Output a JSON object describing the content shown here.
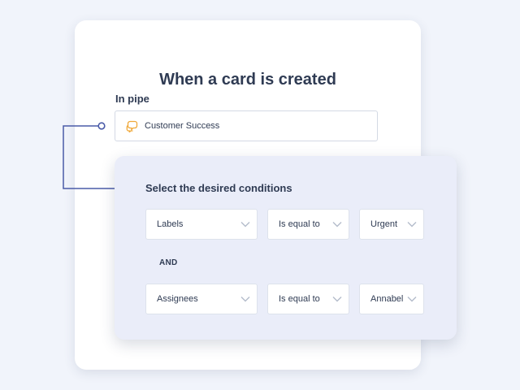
{
  "colors": {
    "background": "#f1f4fb",
    "accent": "#4a5ba8",
    "panel": "#eaedf9",
    "pipe_icon": "#f0a93b"
  },
  "trigger_card": {
    "title": "When a card is created",
    "pipe_label": "In pipe",
    "pipe_value": "Customer Success",
    "pipe_icon": "chat-bubbles-icon"
  },
  "conditions": {
    "title": "Select the desired conditions",
    "rows": [
      {
        "field": "Labels",
        "operator": "Is equal to",
        "value": "Urgent"
      },
      {
        "field": "Assignees",
        "operator": "Is equal to",
        "value": "Annabel"
      }
    ],
    "joiner": "AND"
  }
}
